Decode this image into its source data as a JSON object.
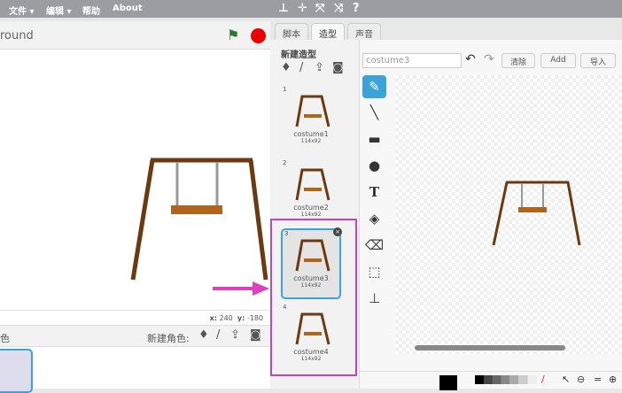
{
  "menubar": {
    "file": "文件 ▾",
    "edit": "编辑 ▾",
    "help": "帮助",
    "about": "About"
  },
  "stage": {
    "title": "round",
    "x_label": "x:",
    "x_value": "240",
    "y_label": "y:",
    "y_value": "-180"
  },
  "sprites": {
    "header_left": "色",
    "new_sprite_label": "新建角色:"
  },
  "tabs": [
    "脚本",
    "造型",
    "声音"
  ],
  "costumes": {
    "new_label": "新建造型",
    "items": [
      {
        "num": "1",
        "name": "costume1",
        "size": "114x92"
      },
      {
        "num": "2",
        "name": "costume2",
        "size": "114x92"
      },
      {
        "num": "3",
        "name": "costume3",
        "size": "114x92"
      },
      {
        "num": "4",
        "name": "costume4",
        "size": "114x92"
      }
    ]
  },
  "paint": {
    "name_value": "costume3",
    "clear": "清除",
    "add": "Add",
    "import": "导入"
  },
  "colors": {
    "accent": "#3aa3d9",
    "highlight": "#c642c6",
    "arrow": "#e040c0",
    "wood": "#6b3a10"
  }
}
